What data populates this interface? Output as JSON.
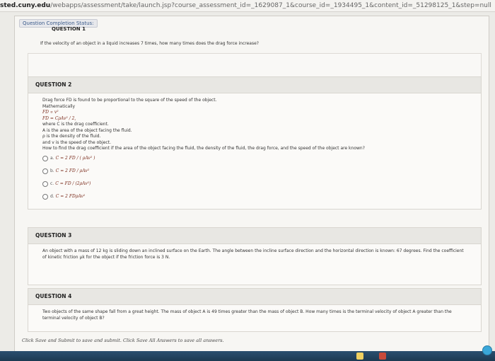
{
  "browser": {
    "url_host": "sted.cuny.edu",
    "url_path": "/webapps/assessment/take/launch.jsp?course_assessment_id=_1629087_1&course_id=_1934495_1&content_id=_51298125_1&step=null"
  },
  "header": {
    "status_link": "Question Completion Status:",
    "cutoff_heading": "QUESTION 1"
  },
  "question1": {
    "text": "If the velocity of an object in a liquid increases 7 times, how many times does the drag force increase?"
  },
  "question2": {
    "title": "QUESTION 2",
    "lines": [
      "Drag force FD is found to be proportional to the square of the speed of the object.",
      "Mathematically",
      "FD ∝ v²",
      "FD = CρAv² / 2,",
      "where C is the drag coefficient.",
      "A is the area of the object facing the fluid.",
      "ρ is the density of the fluid.",
      "and v is the speed of the object.",
      "How to find the drag coefficient if the area of the object facing the fluid, the density of the fluid, the drag force, and the speed of the object are known?"
    ],
    "options": [
      {
        "letter": "a.",
        "formula": "C = 2 FD / ( ρAv² )"
      },
      {
        "letter": "b.",
        "formula": "C = 2 FD / ρAv²"
      },
      {
        "letter": "c.",
        "formula": "C = FD / (2ρAv²)"
      },
      {
        "letter": "d.",
        "formula": "C = 2 FDρAv²"
      }
    ]
  },
  "question3": {
    "title": "QUESTION 3",
    "line1": "An object with a mass of 12 kg is sliding down an inclined surface on the Earth. The angle between the incline surface direction and the horizontal direction is known: 67 degrees. Find the coefficient",
    "line2": "of kinetic friction μk for the object if the friction force is 3 N."
  },
  "question4": {
    "title": "QUESTION 4",
    "line1": "Two objects of the same shape fall from a great height. The mass of object A is 49 times greater than the mass of object B. How many times is the terminal velocity of object A greater than the",
    "line2": "terminal velocity of object B?"
  },
  "footer": {
    "note": "Click Save and Submit to save and submit. Click Save All Answers to save all answers."
  }
}
